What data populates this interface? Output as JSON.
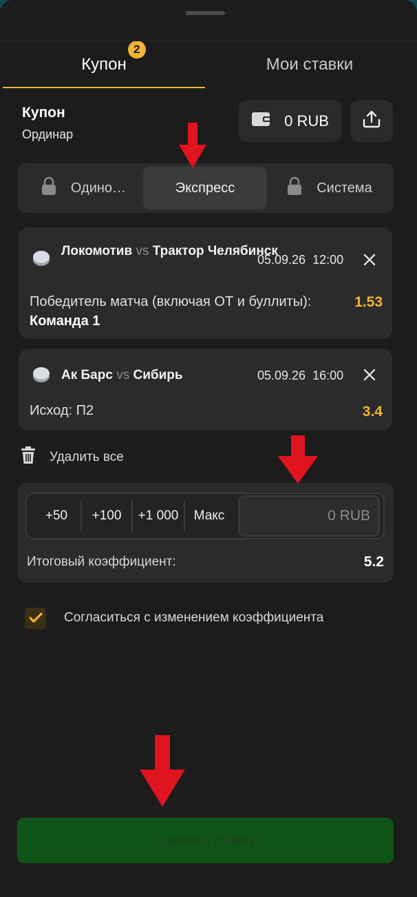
{
  "tabs": [
    {
      "label": "Купон",
      "badge": "2",
      "active": true
    },
    {
      "label": "Мои ставки",
      "active": false
    }
  ],
  "coupon": {
    "title": "Купон",
    "subtitle": "Ординар"
  },
  "balance": {
    "amount": "0 RUB",
    "icon": "wallet-icon"
  },
  "bet_types": [
    {
      "label": "Одино…",
      "locked": true
    },
    {
      "label": "Экспресс",
      "locked": false,
      "selected": true
    },
    {
      "label": "Система",
      "locked": true
    }
  ],
  "events": [
    {
      "home": "Локомотив",
      "vs": "vs",
      "away": "Трактор Челябинск",
      "date": "05.09.26",
      "time": "12:00",
      "market": "Победитель матча (включая ОТ и буллиты):",
      "outcome": "Команда 1",
      "odd": "1.53"
    },
    {
      "home": "Ак Барс",
      "vs": "vs",
      "away": "Сибирь",
      "date": "05.09.26",
      "time": "16:00",
      "market": "Исход:",
      "outcome": "П2",
      "odd": "3.4"
    }
  ],
  "delete_all": "Удалить все",
  "stake": {
    "quick": [
      "+50",
      "+100",
      "+1 000",
      "Макс"
    ],
    "placeholder": "0 RUB"
  },
  "total": {
    "label": "Итоговый коэффициент:",
    "value": "5.2"
  },
  "agree": {
    "label": "Согласиться с изменением коэффициента",
    "checked": true
  },
  "submit": {
    "label": "Сделать ставку"
  },
  "colors": {
    "accent": "#f5b335",
    "submit_bg": "#0f5417",
    "annotation_arrow": "#e0141e"
  }
}
